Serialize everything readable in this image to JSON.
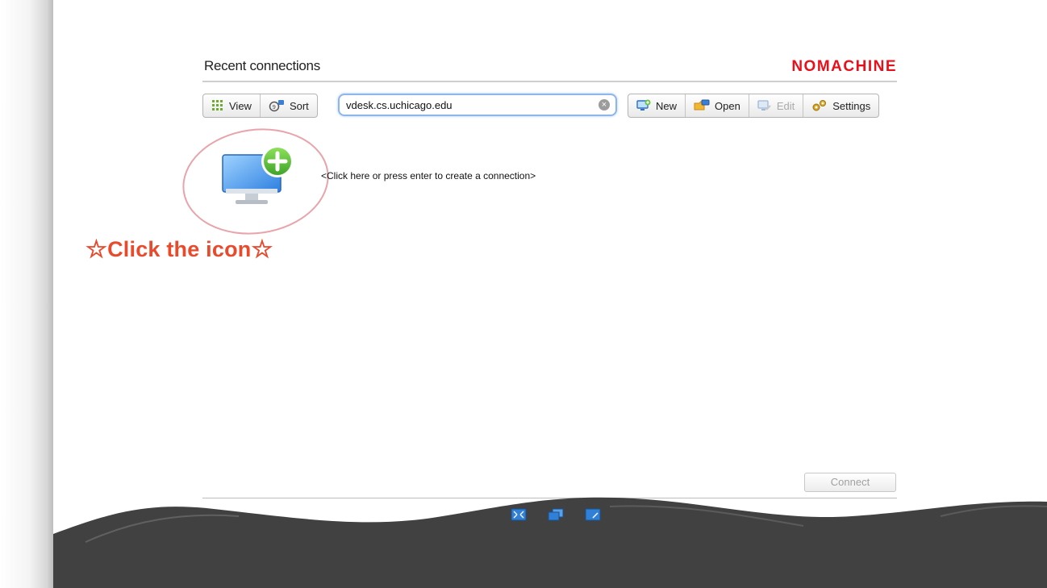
{
  "header": {
    "title": "Recent connections",
    "logo_text": "NOMACHINE"
  },
  "toolbar": {
    "view_label": "View",
    "sort_label": "Sort",
    "new_label": "New",
    "open_label": "Open",
    "edit_label": "Edit",
    "settings_label": "Settings"
  },
  "search": {
    "value": "vdesk.cs.uchicago.edu",
    "clear_glyph": "×"
  },
  "main": {
    "create_hint": "<Click here or press enter to create a connection>",
    "annotation": "Click the icon",
    "star": "☆"
  },
  "footer": {
    "connect_label": "Connect"
  },
  "colors": {
    "brand": "#e8101a",
    "annotation": "#e94a2c",
    "wave": "#414141"
  },
  "icons": [
    "grid-icon",
    "sort-icon",
    "new-monitor-icon",
    "open-folder-icon",
    "edit-monitor-icon",
    "settings-gears-icon",
    "clear-icon",
    "monitor-plus-icon",
    "fullscreen-icon",
    "window-icon",
    "screen-icon"
  ]
}
